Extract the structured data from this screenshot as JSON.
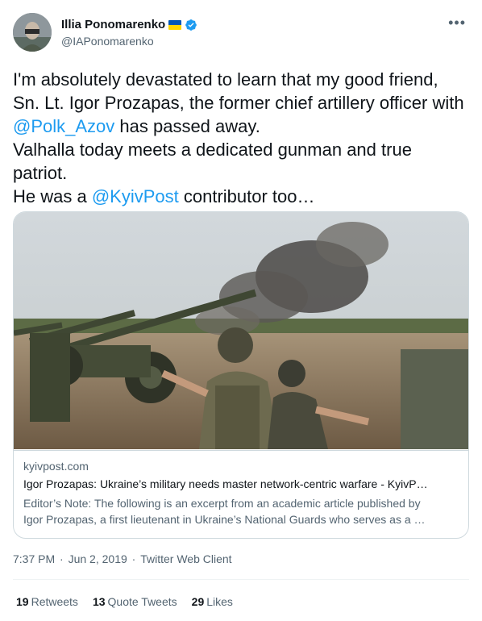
{
  "author": {
    "name": "Illia Ponomarenko",
    "handle": "@IAPonomarenko",
    "more_icon": "more-dots-icon",
    "badge_colors": {
      "flag_top": "#0057b7",
      "flag_bottom": "#ffd700",
      "verified": "#1d9bf0"
    }
  },
  "tweet": {
    "line1_a": "I'm absolutely devastated to learn that my good friend, Sn. Lt. Igor Prozapas, the former chief artillery officer with ",
    "line1_mention": "@Polk_Azov",
    "line1_b": " has passed away.",
    "line2": "Valhalla today meets a dedicated gunman and true patriot.",
    "line3_a": "He was a ",
    "line3_mention": "@KyivPost",
    "line3_b": " contributor too…"
  },
  "card": {
    "domain": "kyivpost.com",
    "title": "Igor Prozapas: Ukraine’s military needs master network-centric warfare - KyivP…",
    "desc_line1": "Editor’s Note: The following is an excerpt from an academic article published by",
    "desc_line2": "Igor Prozapas, a first lieutenant in Ukraine’s National Guards who serves as a …"
  },
  "meta": {
    "time": "7:37 PM",
    "sep1": " · ",
    "date": "Jun 2, 2019",
    "sep2": " · ",
    "client": "Twitter Web Client"
  },
  "stats": {
    "retweets_count": "19",
    "retweets_label": "Retweets",
    "quotes_count": "13",
    "quotes_label": "Quote Tweets",
    "likes_count": "29",
    "likes_label": "Likes"
  },
  "colors": {
    "text": "#0f1419",
    "secondary": "#536471",
    "link": "#1d9bf0",
    "border": "#cfd9de"
  }
}
